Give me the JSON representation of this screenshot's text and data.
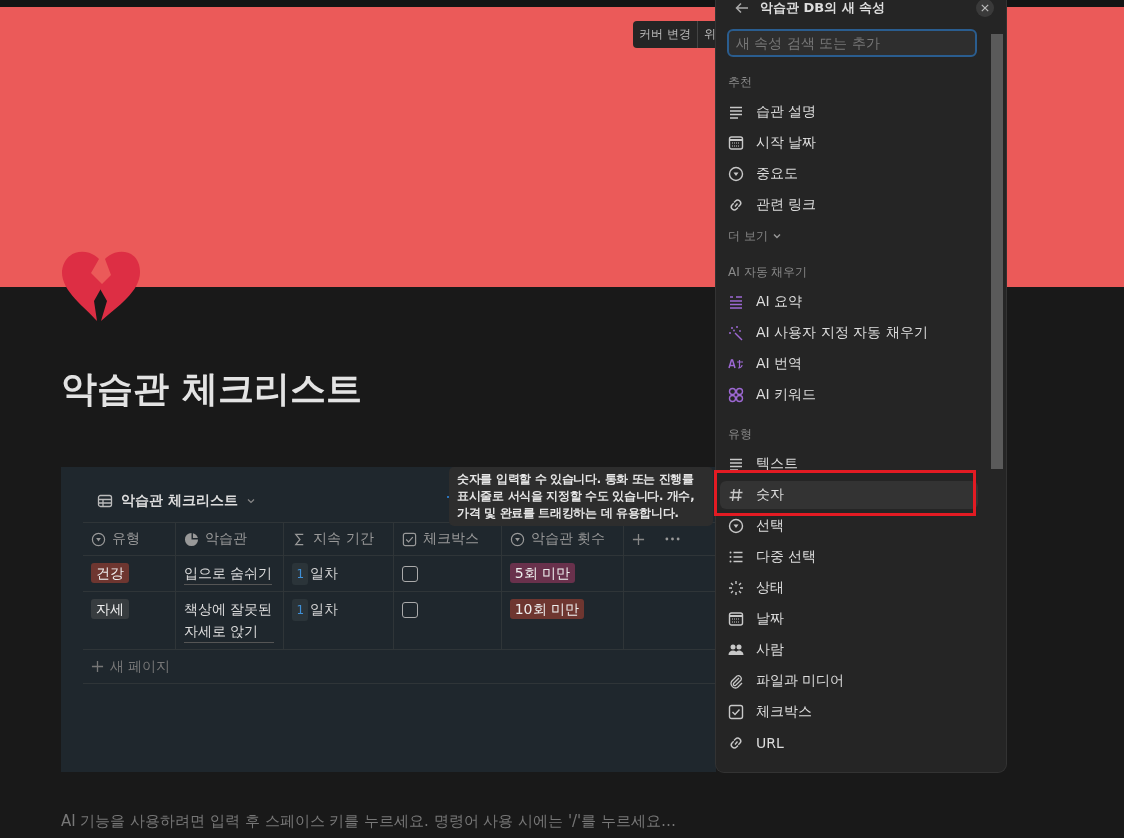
{
  "cover": {
    "buttons": [
      "커버 변경",
      "위"
    ]
  },
  "page": {
    "title": "악습관 체크리스트"
  },
  "database": {
    "view_title": "악습관 체크리스트",
    "columns": [
      {
        "label": "유형",
        "kind": "select"
      },
      {
        "label": "악습관",
        "kind": "relation"
      },
      {
        "label": "지속 기간",
        "kind": "formula"
      },
      {
        "label": "체크박스",
        "kind": "checkbox"
      },
      {
        "label": "악습관 횟수",
        "kind": "select"
      }
    ],
    "rows": [
      {
        "type": {
          "text": "건강",
          "color": "#6e3630"
        },
        "habit": "입으로 숨쉬기",
        "duration_badge": "1",
        "duration": "일차",
        "checked": false,
        "count": {
          "text": "5회 미만",
          "color": "#69314c"
        }
      },
      {
        "type": {
          "text": "자세",
          "color": "#373c3f"
        },
        "habit": "책상에 잘못된 자세로 앉기",
        "duration_badge": "1",
        "duration": "일차",
        "checked": false,
        "count": {
          "text": "10회 미만",
          "color": "#6e3630"
        }
      }
    ],
    "new_page": "새 페이지"
  },
  "placeholder_hint": "AI 기능을 사용하려면 입력 후 스페이스 키를 누르세요. 명령어 사용 시에는 '/'를 누르세요…",
  "tooltip": "숫자를 입력할 수 있습니다. 통화 또는 진행률 표시줄로 서식을 지정할 수도 있습니다. 개수, 가격 및 완료를 트래킹하는 데 유용합니다.",
  "panel": {
    "title": "악습관 DB의 새 속성",
    "search": {
      "placeholder": "새 속성 검색 또는 추가"
    },
    "sections": [
      {
        "label": "추천",
        "items": [
          {
            "label": "습관 설명",
            "kind": "lines",
            "selected": false
          },
          {
            "label": "시작 날짜",
            "kind": "calendar",
            "selected": false
          },
          {
            "label": "중요도",
            "kind": "select",
            "selected": false
          },
          {
            "label": "관련 링크",
            "kind": "link",
            "selected": false
          }
        ],
        "more": "더 보기"
      },
      {
        "label": "AI 자동 채우기",
        "items": [
          {
            "label": "AI 요약",
            "kind": "ai-summary",
            "selected": false
          },
          {
            "label": "AI 사용자 지정 자동 채우기",
            "kind": "ai-sparkle",
            "selected": false
          },
          {
            "label": "AI 번역",
            "kind": "ai-translate",
            "selected": false
          },
          {
            "label": "AI 키워드",
            "kind": "ai-keywords",
            "selected": false
          }
        ]
      },
      {
        "label": "유형",
        "items": [
          {
            "label": "텍스트",
            "kind": "lines",
            "selected": false
          },
          {
            "label": "숫자",
            "kind": "number",
            "selected": true
          },
          {
            "label": "선택",
            "kind": "select",
            "selected": false
          },
          {
            "label": "다중 선택",
            "kind": "list",
            "selected": false
          },
          {
            "label": "상태",
            "kind": "status",
            "selected": false
          },
          {
            "label": "날짜",
            "kind": "calendar",
            "selected": false
          },
          {
            "label": "사람",
            "kind": "people",
            "selected": false
          },
          {
            "label": "파일과 미디어",
            "kind": "clip",
            "selected": false
          },
          {
            "label": "체크박스",
            "kind": "checkbox",
            "selected": false
          },
          {
            "label": "URL",
            "kind": "link",
            "selected": false
          }
        ]
      }
    ]
  }
}
